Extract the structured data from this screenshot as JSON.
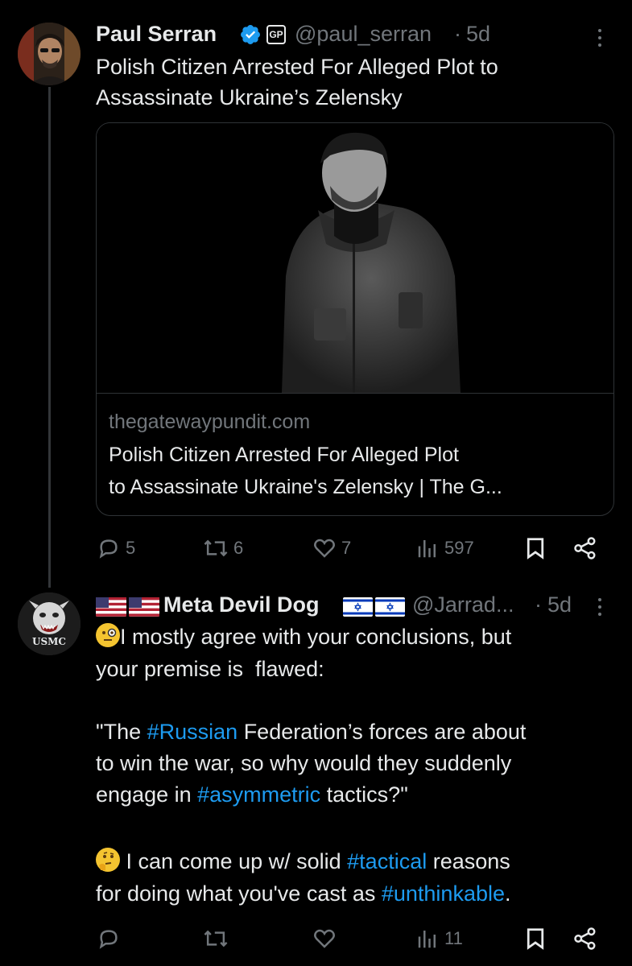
{
  "tweet1": {
    "author_name": "Paul Serran",
    "handle": "@paul_serran",
    "separator": "·",
    "time": "5d",
    "badge_label": "GP",
    "text": "Polish Citizen Arrested For Alleged Plot to Assassinate Ukraine’s Zelensky",
    "link_card": {
      "domain": "thegatewaypundit.com",
      "title_line1": "Polish Citizen Arrested For Alleged Plot",
      "title_line2": "to Assassinate Ukraine's Zelensky | The G..."
    },
    "actions": {
      "replies": "5",
      "reposts": "6",
      "likes": "7",
      "views": "597"
    }
  },
  "tweet2": {
    "author_name": "Meta Devil Dog",
    "handle": "@Jarrad...",
    "separator": "·",
    "time": "5d",
    "avatar_text": "USMC",
    "paragraph1": {
      "line1": "I mostly agree with your conclusions, but",
      "line2": "your premise is  flawed:"
    },
    "paragraph2": {
      "l1_a": "\"The ",
      "l1_tag": "#Russian",
      "l1_b": " Federation’s forces are about",
      "l2": "to win the war, so why would they suddenly",
      "l3_a": "engage in ",
      "l3_tag": "#asymmetric",
      "l3_b": " tactics?\""
    },
    "paragraph3": {
      "l1_a": "I can come up w/ solid ",
      "l1_tag": "#tactical",
      "l1_b": " reasons",
      "l2_a": "for doing what you've cast as ",
      "l2_tag": "#unthinkable",
      "l2_b": "."
    },
    "actions": {
      "views": "11"
    }
  },
  "colors": {
    "background": "#000000",
    "text": "#e7e9ea",
    "muted": "#71767b",
    "link": "#1d9bf0",
    "verified": "#1d9bf0",
    "divider": "#2f3336"
  }
}
